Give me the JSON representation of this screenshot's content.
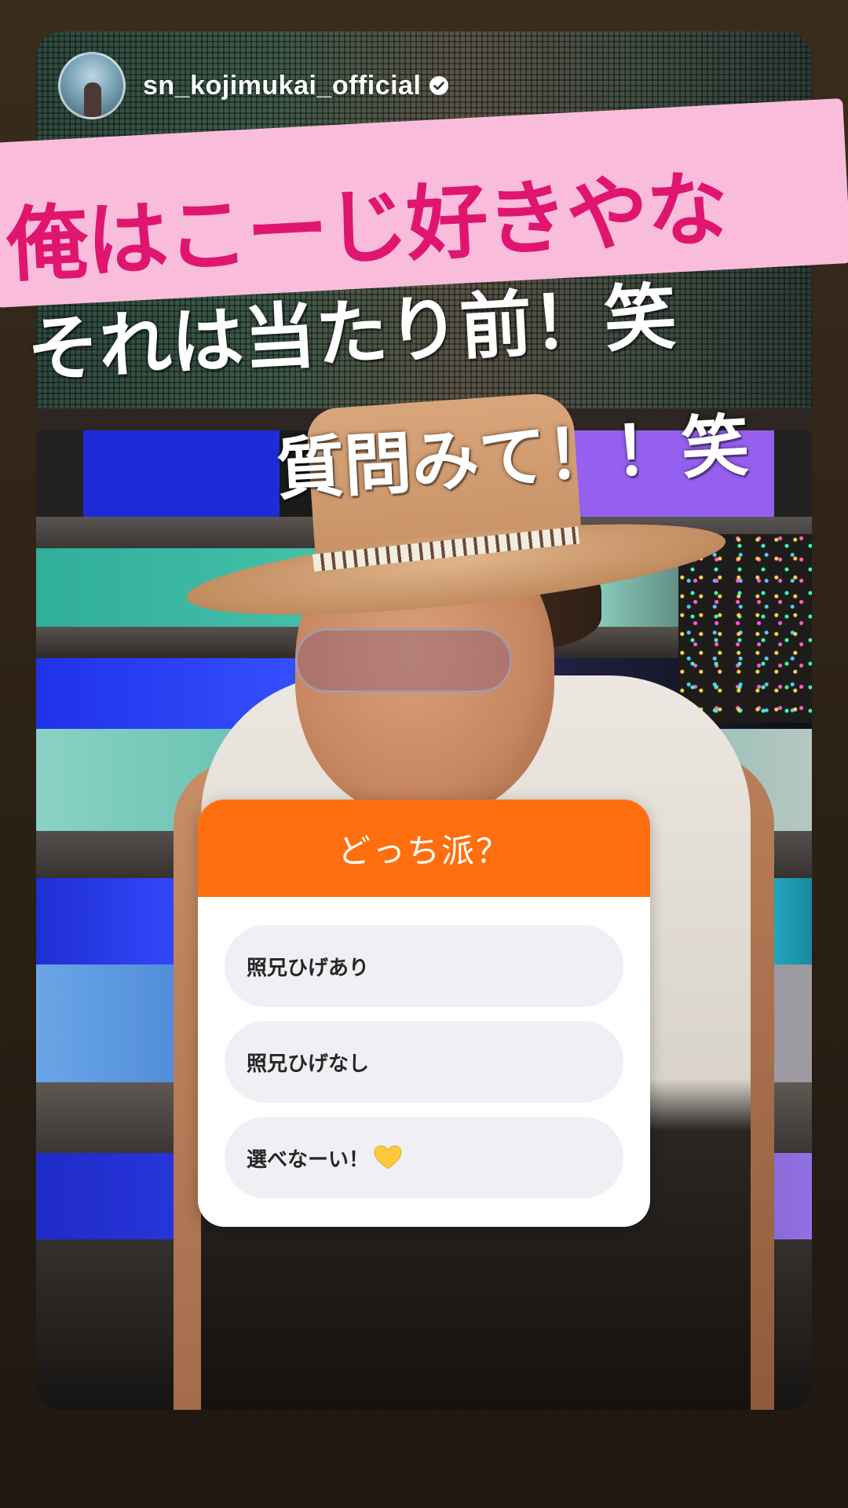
{
  "story": {
    "username": "sn_kojimukai_official",
    "verified": true
  },
  "captions": {
    "main": "俺はこーじ好きやな",
    "line2": "それは当たり前！笑",
    "line3": "質問みて！！笑"
  },
  "poll": {
    "question": "どっち派？",
    "options": [
      {
        "label": "照兄ひげあり"
      },
      {
        "label": "照兄ひげなし"
      },
      {
        "label": "選べなーい！",
        "emoji": "yellow-heart-icon"
      }
    ]
  },
  "colors": {
    "poll_header": "#ff6f0f",
    "caption_pink": "#e0156f",
    "banner_pink": "#f9bddb",
    "option_bg": "#efeff4"
  }
}
